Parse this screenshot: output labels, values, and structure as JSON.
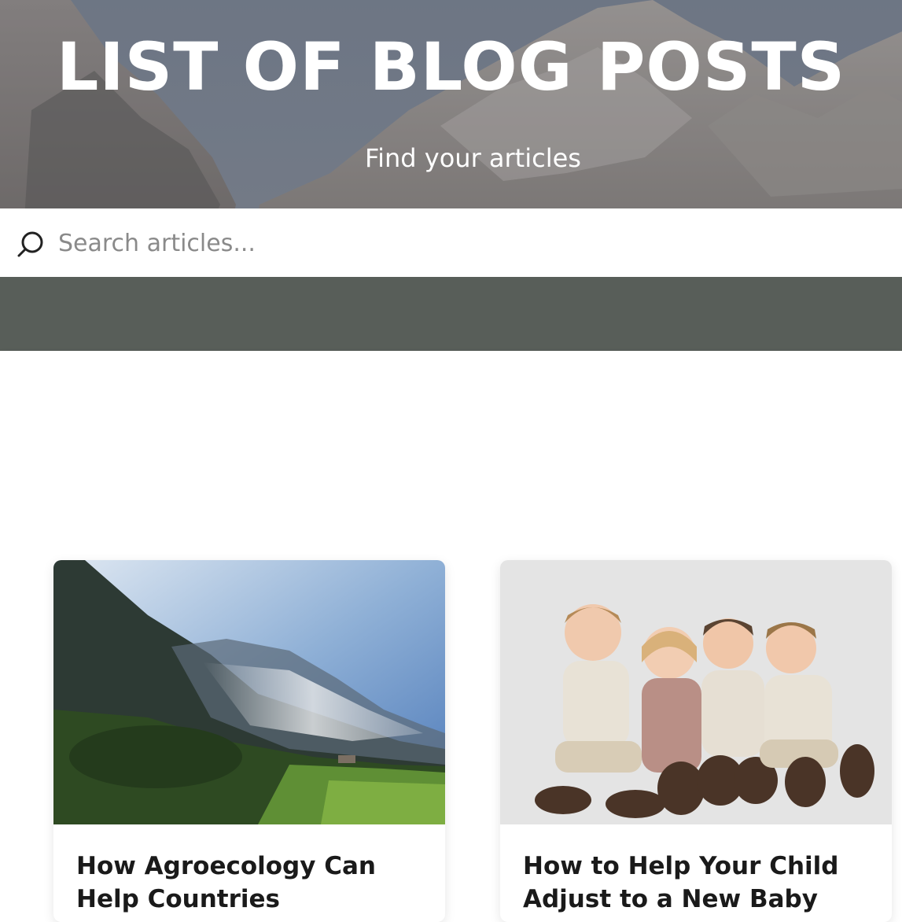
{
  "hero": {
    "title": "LIST OF BLOG POSTS",
    "subtitle": "Find your articles"
  },
  "search": {
    "placeholder": "Search articles...",
    "value": "",
    "icon": "search-icon"
  },
  "posts": [
    {
      "title": "How Agroecology Can Help Countries",
      "image": "mountain-valley-photo"
    },
    {
      "title": "How to Help Your Child Adjust to a New Baby",
      "image": "children-group-photo"
    }
  ],
  "colors": {
    "title_text": "#ffffff",
    "card_title": "#1a1a1a",
    "placeholder": "#8a8a8a"
  }
}
